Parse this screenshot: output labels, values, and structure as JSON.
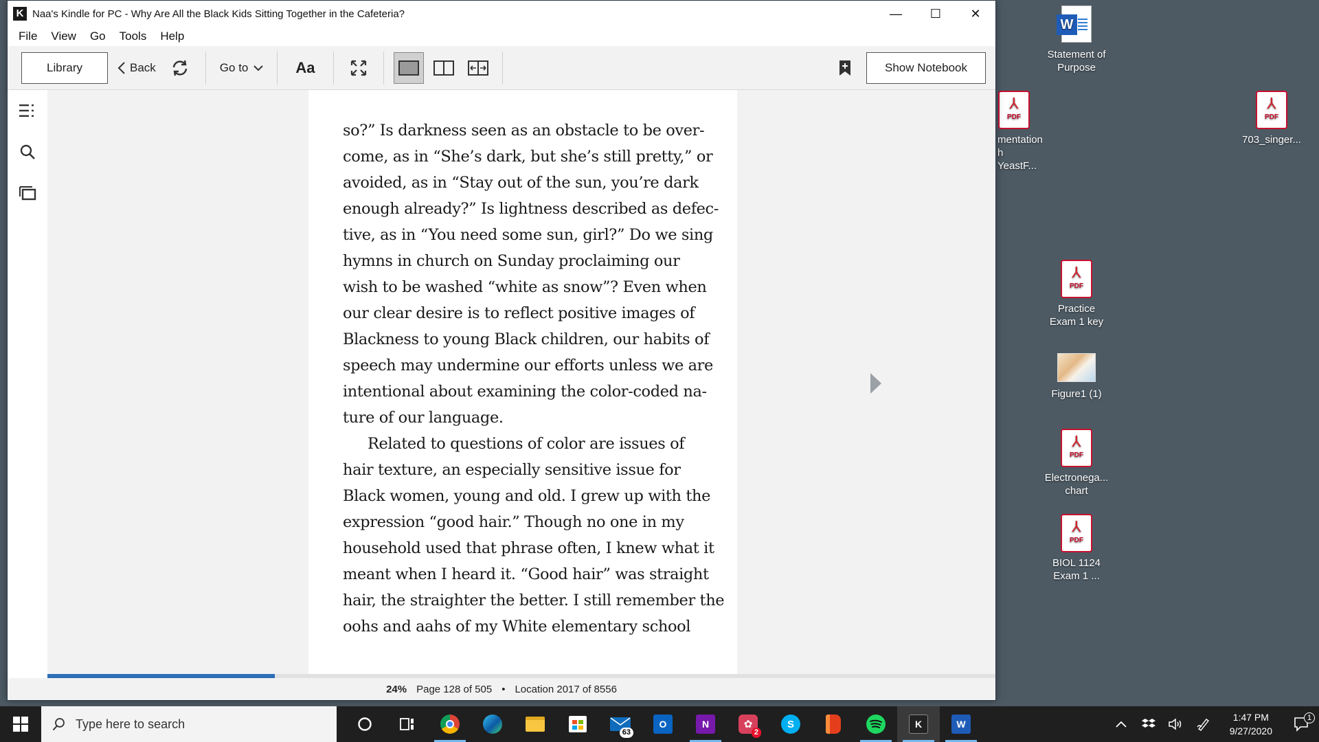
{
  "window": {
    "title": "Naa's Kindle for PC - Why Are All the Black Kids Sitting Together in the Cafeteria?",
    "app_logo": "K",
    "controls": {
      "minimize": "—",
      "maximize": "☐",
      "close": "✕"
    }
  },
  "menu": [
    "File",
    "View",
    "Go",
    "Tools",
    "Help"
  ],
  "toolbar": {
    "library": "Library",
    "back": "Back",
    "goto": "Go to",
    "font": "Aa",
    "show_notebook": "Show Notebook"
  },
  "book": {
    "lines": [
      "so?” Is darkness seen as an obstacle to be over-",
      "come, as in “She’s dark, but she’s still pretty,” or",
      "avoided, as in “Stay out of the sun, you’re dark",
      "enough already?” Is lightness described as defec-",
      "tive, as in “You need some sun, girl?” Do we sing",
      "hymns in church on Sunday proclaiming our",
      "wish to be washed “white as snow”? Even when",
      "our clear desire is to reflect positive images of",
      "Blackness to young Black children, our habits of",
      "speech may undermine our efforts unless we are",
      "intentional about examining the color-coded na-",
      "ture of our language.",
      "Related to questions of color are issues of",
      "hair texture, an especially sensitive issue for",
      "Black women, young and old. I grew up with the",
      "expression “good hair.” Though no one in my",
      "household used that phrase often, I knew what it",
      "meant when I heard it. “Good hair” was straight",
      "hair, the straighter the better. I still remember the",
      "oohs and aahs of my White elementary school"
    ],
    "progress_fraction": 0.24
  },
  "status": {
    "percent": "24%",
    "page": "Page 128 of 505",
    "separator": "•",
    "location": "Location 2017 of 8556"
  },
  "desktop": {
    "icons": [
      {
        "label1": "Statement of",
        "label2": "Purpose",
        "type": "word"
      },
      {
        "label1": "mentation",
        "label2": "h YeastF...",
        "type": "pdf"
      },
      {
        "label1": "703_singer...",
        "label2": "",
        "type": "pdf"
      },
      {
        "label1": "Practice",
        "label2": "Exam 1 key",
        "type": "pdf"
      },
      {
        "label1": "Figure1 (1)",
        "label2": "",
        "type": "image"
      },
      {
        "label1": "Electronega...",
        "label2": "chart",
        "type": "pdf"
      },
      {
        "label1": "BIOL 1124",
        "label2": "Exam 1 ...",
        "type": "pdf"
      }
    ],
    "pdf_label": "PDF"
  },
  "taskbar": {
    "search_placeholder": "Type here to search",
    "mail_badge": "63",
    "teams_badge": "2",
    "onenote_letter": "N",
    "skype_letter": "S",
    "outlook_letter": "O",
    "word_letter": "W",
    "kindle_letter": "K",
    "time": "1:47 PM",
    "date": "9/27/2020",
    "notification_count": "1"
  },
  "colors": {
    "desktop_bg": "#4d5a64",
    "progress": "#2d6fb7",
    "taskbar": "#1f1f1f",
    "pdf_red": "#c8102e",
    "word_blue": "#1e5cb8"
  }
}
